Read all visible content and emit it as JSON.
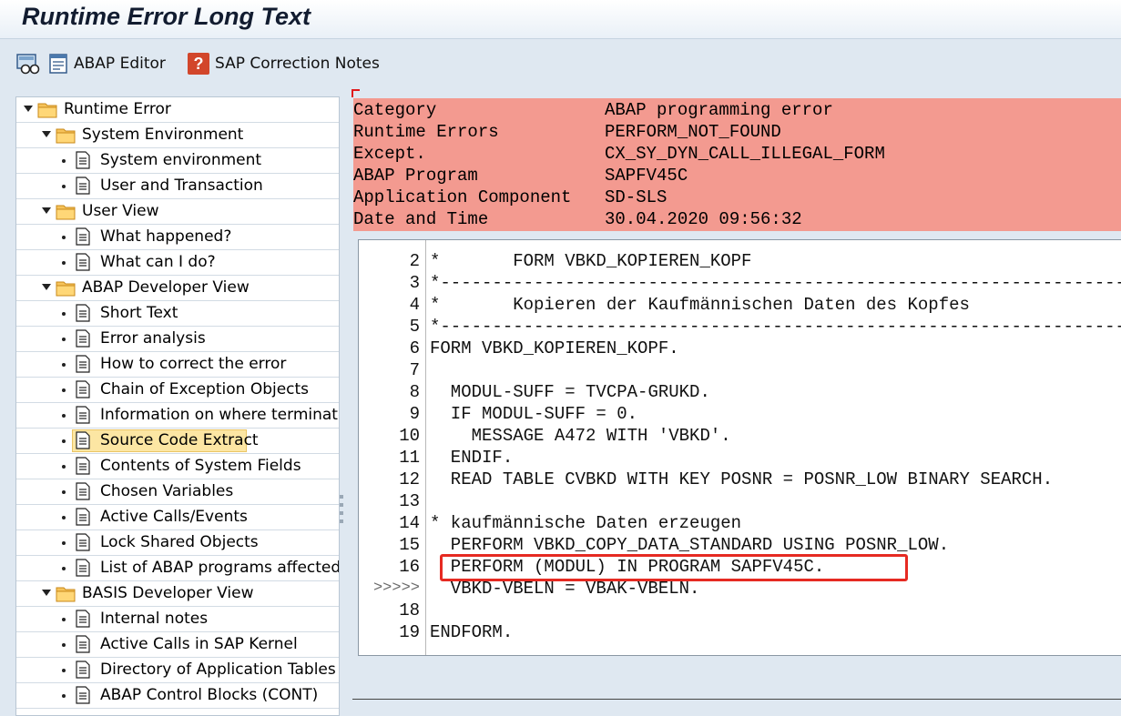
{
  "title": "Runtime Error Long Text",
  "toolbar": {
    "editor_label": "ABAP Editor",
    "notes_label": "SAP Correction Notes",
    "display_icon": "glasses-display-icon",
    "editor_icon": "abap-editor-icon",
    "notes_icon": "question-mark-icon"
  },
  "tree": {
    "root": "Runtime Error",
    "groups": [
      {
        "label": "System Environment",
        "items": [
          "System environment",
          "User and Transaction"
        ]
      },
      {
        "label": "User View",
        "items": [
          "What happened?",
          "What can I do?"
        ]
      },
      {
        "label": "ABAP Developer View",
        "items": [
          "Short Text",
          "Error analysis",
          "How to correct the error",
          "Chain of Exception Objects",
          "Information on where terminated",
          "Source Code Extract",
          "Contents of System Fields",
          "Chosen Variables",
          "Active Calls/Events",
          "Lock Shared Objects",
          "List of ABAP programs affected"
        ]
      },
      {
        "label": "BASIS Developer View",
        "items": [
          "Internal notes",
          "Active Calls in SAP Kernel",
          "Directory of Application Tables",
          "ABAP Control Blocks (CONT)"
        ]
      }
    ],
    "selected": "Source Code Extract"
  },
  "header": [
    {
      "key": "Category",
      "value": "ABAP programming error"
    },
    {
      "key": "Runtime Errors",
      "value": "PERFORM_NOT_FOUND"
    },
    {
      "key": "Except.",
      "value": "CX_SY_DYN_CALL_ILLEGAL_FORM"
    },
    {
      "key": "ABAP Program",
      "value": "SAPFV45C"
    },
    {
      "key": "Application Component",
      "value": "SD-SLS"
    },
    {
      "key": "Date and Time",
      "value": "30.04.2020 09:56:32"
    }
  ],
  "code": [
    {
      "ln": "2",
      "text": "*       FORM VBKD_KOPIEREN_KOPF"
    },
    {
      "ln": "3",
      "text": "*---------------------------------------------------------------------"
    },
    {
      "ln": "4",
      "text": "*       Kopieren der Kaufmännischen Daten des Kopfes"
    },
    {
      "ln": "5",
      "text": "*---------------------------------------------------------------------"
    },
    {
      "ln": "6",
      "text": "FORM VBKD_KOPIEREN_KOPF."
    },
    {
      "ln": "7",
      "text": ""
    },
    {
      "ln": "8",
      "text": "  MODUL-SUFF = TVCPA-GRUKD."
    },
    {
      "ln": "9",
      "text": "  IF MODUL-SUFF = 0."
    },
    {
      "ln": "10",
      "text": "    MESSAGE A472 WITH 'VBKD'."
    },
    {
      "ln": "11",
      "text": "  ENDIF."
    },
    {
      "ln": "12",
      "text": "  READ TABLE CVBKD WITH KEY POSNR = POSNR_LOW BINARY SEARCH."
    },
    {
      "ln": "13",
      "text": ""
    },
    {
      "ln": "14",
      "text": "* kaufmännische Daten erzeugen"
    },
    {
      "ln": "15",
      "text": "  PERFORM VBKD_COPY_DATA_STANDARD USING POSNR_LOW."
    },
    {
      "ln": "16",
      "text": "  PERFORM (MODUL) IN PROGRAM SAPFV45C."
    },
    {
      "ln": ">>>>>",
      "text": "  VBKD-VBELN = VBAK-VBELN."
    },
    {
      "ln": "18",
      "text": ""
    },
    {
      "ln": "19",
      "text": "ENDFORM."
    }
  ],
  "colors": {
    "header_bg": "#f39a90",
    "selection_bg": "#fce6a3",
    "highlight_box": "#e62a22",
    "panel_bg": "#dfe8f1"
  }
}
